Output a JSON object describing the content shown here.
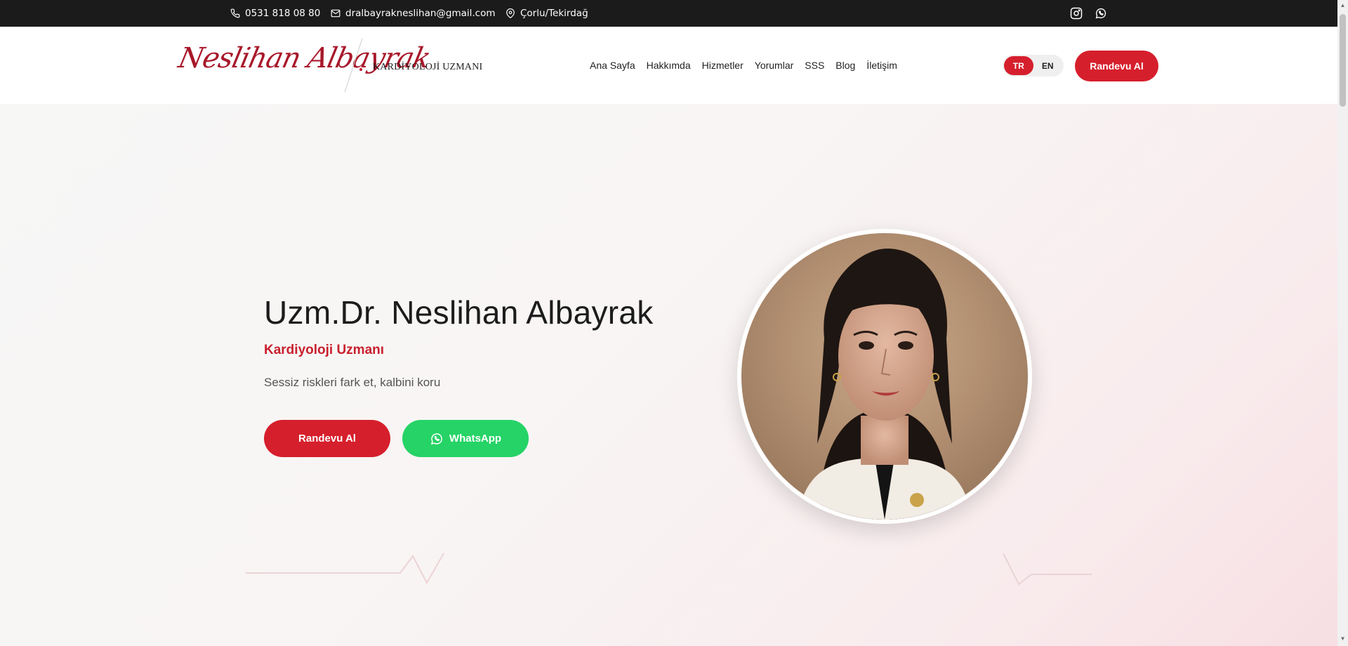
{
  "topbar": {
    "phone": "0531 818 08 80",
    "email": "dralbayrakneslihan@gmail.com",
    "location": "Çorlu/Tekirdağ",
    "icons": [
      "phone-icon",
      "mail-icon",
      "location-pin-icon",
      "instagram-icon",
      "whatsapp-icon"
    ]
  },
  "header": {
    "logo_name": "Neslihan Albayrak",
    "logo_subtitle": "KARDİYOLOJİ UZMANI",
    "nav": [
      "Ana Sayfa",
      "Hakkımda",
      "Hizmetler",
      "Yorumlar",
      "SSS",
      "Blog",
      "İletişim"
    ],
    "lang": {
      "tr": "TR",
      "en": "EN",
      "active": "TR"
    },
    "cta": "Randevu Al"
  },
  "hero": {
    "title": "Uzm.Dr. Neslihan Albayrak",
    "subtitle": "Kardiyoloji Uzmanı",
    "tagline": "Sessiz riskleri fark et, kalbini koru",
    "btn_appointment": "Randevu Al",
    "btn_whatsapp": "WhatsApp"
  },
  "colors": {
    "accent": "#d61f2c",
    "whatsapp": "#25d366",
    "topbar": "#1b1b1b",
    "logo": "#a8182a"
  }
}
